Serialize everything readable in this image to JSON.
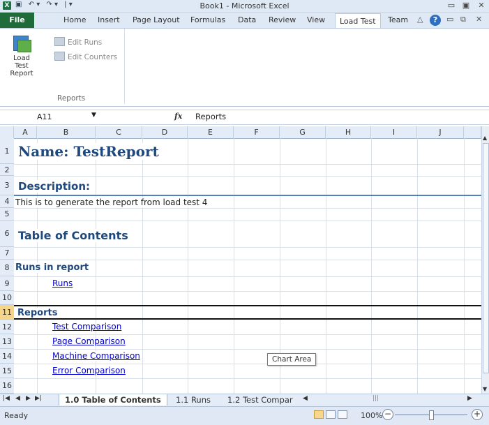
{
  "window": {
    "title": "Book1 - Microsoft Excel",
    "app_icon": "X",
    "qat_icons": [
      "save-icon",
      "undo-icon",
      "redo-icon",
      "customize-icon"
    ],
    "controls": [
      "minimize-icon",
      "restore-icon",
      "close-icon"
    ]
  },
  "ribbon_tabs": [
    "File",
    "Home",
    "Insert",
    "Page Layout",
    "Formulas",
    "Data",
    "Review",
    "View",
    "Load Test",
    "Team"
  ],
  "active_tab": "Load Test",
  "ribbon": {
    "big_button": {
      "label_line1": "Load Test",
      "label_line2": "Report"
    },
    "edit_runs": "Edit Runs",
    "edit_counters": "Edit Counters",
    "group_label": "Reports"
  },
  "formula_bar": {
    "name_box": "A11",
    "fx": "fx",
    "value": "Reports"
  },
  "columns": [
    "A",
    "B",
    "C",
    "D",
    "E",
    "F",
    "G",
    "H",
    "I",
    "J"
  ],
  "rows": [
    "1",
    "2",
    "3",
    "4",
    "5",
    "6",
    "7",
    "8",
    "9",
    "10",
    "11",
    "12",
    "13",
    "14",
    "15",
    "16"
  ],
  "selected_row": "11",
  "cells": {
    "r1": "Name: TestReport",
    "r3": "Description:",
    "r4": "This is to generate the report from load test 4",
    "r6": "Table of Contents",
    "r8": "Runs in report",
    "r9": "Runs",
    "r11": "Reports",
    "r12": "Test Comparison",
    "r13": "Page Comparison",
    "r14": "Machine Comparison",
    "r15": "Error Comparison"
  },
  "tooltip": "Chart Area",
  "sheet_tabs": [
    "1.0 Table of Contents",
    "1.1 Runs",
    "1.2 Test Compar"
  ],
  "active_sheet": "1.0 Table of Contents",
  "status": {
    "text": "Ready",
    "zoom": "100%"
  },
  "colors": {
    "heading": "#1f497d",
    "link": "#0000cc",
    "file_tab": "#1f6b3a",
    "rule": "#4f81bd"
  }
}
